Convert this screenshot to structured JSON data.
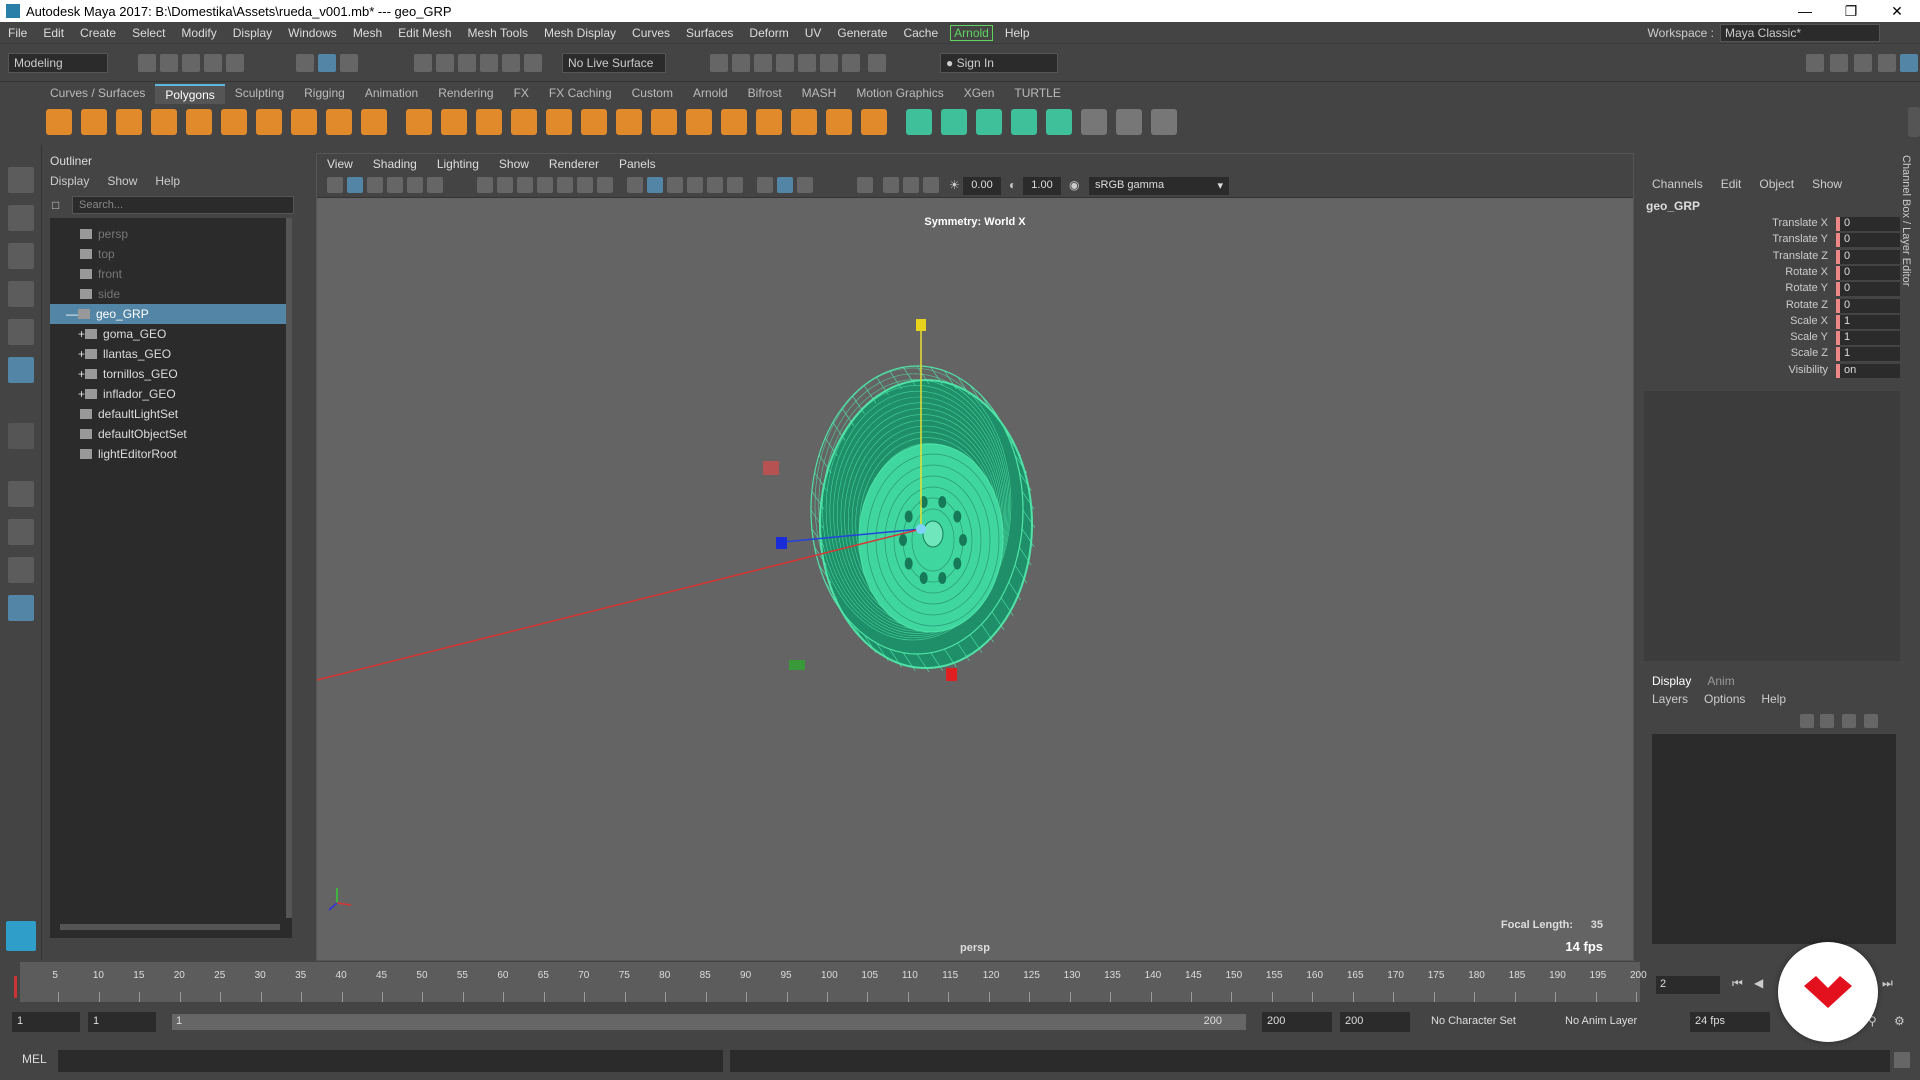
{
  "titlebar": {
    "title": "Autodesk Maya 2017: B:\\Domestika\\Assets\\rueda_v001.mb*   ---   geo_GRP"
  },
  "menubar": {
    "items": [
      "File",
      "Edit",
      "Create",
      "Select",
      "Modify",
      "Display",
      "Windows",
      "Mesh",
      "Edit Mesh",
      "Mesh Tools",
      "Mesh Display",
      "Curves",
      "Surfaces",
      "Deform",
      "UV",
      "Generate",
      "Cache",
      "Arnold",
      "Help"
    ]
  },
  "workspace": {
    "label": "Workspace :",
    "value": "Maya Classic*"
  },
  "statusline": {
    "mode": "Modeling",
    "live_surface": "No Live Surface",
    "sign_in": "Sign In"
  },
  "shelf": {
    "tabs": [
      "Curves / Surfaces",
      "Polygons",
      "Sculpting",
      "Rigging",
      "Animation",
      "Rendering",
      "FX",
      "FX Caching",
      "Custom",
      "Arnold",
      "Bifrost",
      "MASH",
      "Motion Graphics",
      "XGen",
      "TURTLE"
    ],
    "active": "Polygons"
  },
  "outliner": {
    "title": "Outliner",
    "menu": [
      "Display",
      "Show",
      "Help"
    ],
    "search_placeholder": "Search...",
    "rows": [
      {
        "label": "persp",
        "dim": true
      },
      {
        "label": "top",
        "dim": true
      },
      {
        "label": "front",
        "dim": true
      },
      {
        "label": "side",
        "dim": true
      },
      {
        "label": "geo_GRP",
        "selected": true
      },
      {
        "label": "goma_GEO"
      },
      {
        "label": "llantas_GEO"
      },
      {
        "label": "tornillos_GEO"
      },
      {
        "label": "inflador_GEO"
      },
      {
        "label": "defaultLightSet"
      },
      {
        "label": "defaultObjectSet"
      },
      {
        "label": "lightEditorRoot"
      }
    ]
  },
  "viewport": {
    "menu": [
      "View",
      "Shading",
      "Lighting",
      "Show",
      "Renderer",
      "Panels"
    ],
    "exposure": "0.00",
    "gamma_value": "1.00",
    "color_space": "sRGB gamma",
    "symmetry": "Symmetry: World X",
    "focal_label": "Focal Length:",
    "focal_value": "35",
    "fps": "14 fps",
    "camera": "persp",
    "wire_color": "#4fe3a8"
  },
  "channelbox": {
    "menu": [
      "Channels",
      "Edit",
      "Object",
      "Show"
    ],
    "object": "geo_GRP",
    "attrs": [
      {
        "name": "Translate X",
        "value": "0"
      },
      {
        "name": "Translate Y",
        "value": "0"
      },
      {
        "name": "Translate Z",
        "value": "0"
      },
      {
        "name": "Rotate X",
        "value": "0"
      },
      {
        "name": "Rotate Y",
        "value": "0"
      },
      {
        "name": "Rotate Z",
        "value": "0"
      },
      {
        "name": "Scale X",
        "value": "1"
      },
      {
        "name": "Scale Y",
        "value": "1"
      },
      {
        "name": "Scale Z",
        "value": "1"
      },
      {
        "name": "Visibility",
        "value": "on"
      }
    ]
  },
  "layereditor": {
    "tabs": [
      "Display",
      "Anim"
    ],
    "menu": [
      "Layers",
      "Options",
      "Help"
    ]
  },
  "sidetabs": {
    "label": "Channel Box / Layer Editor"
  },
  "timeslider": {
    "ticks": [
      "5",
      "10",
      "15",
      "20",
      "25",
      "30",
      "35",
      "40",
      "45",
      "50",
      "55",
      "60",
      "65",
      "70",
      "75",
      "80",
      "85",
      "90",
      "95",
      "100",
      "105",
      "110",
      "115",
      "120",
      "125",
      "130",
      "135",
      "140",
      "145",
      "150",
      "155",
      "160",
      "165",
      "170",
      "175",
      "180",
      "185",
      "190",
      "195",
      "200"
    ],
    "current_frame": "2"
  },
  "rangeslider": {
    "start": "1",
    "anim_start": "1",
    "range_start": "1",
    "range_end": "200",
    "anim_end": "200",
    "end": "200",
    "character_set": "No Character Set",
    "anim_layer": "No Anim Layer",
    "fps": "24 fps"
  },
  "cmdline": {
    "label": "MEL"
  }
}
